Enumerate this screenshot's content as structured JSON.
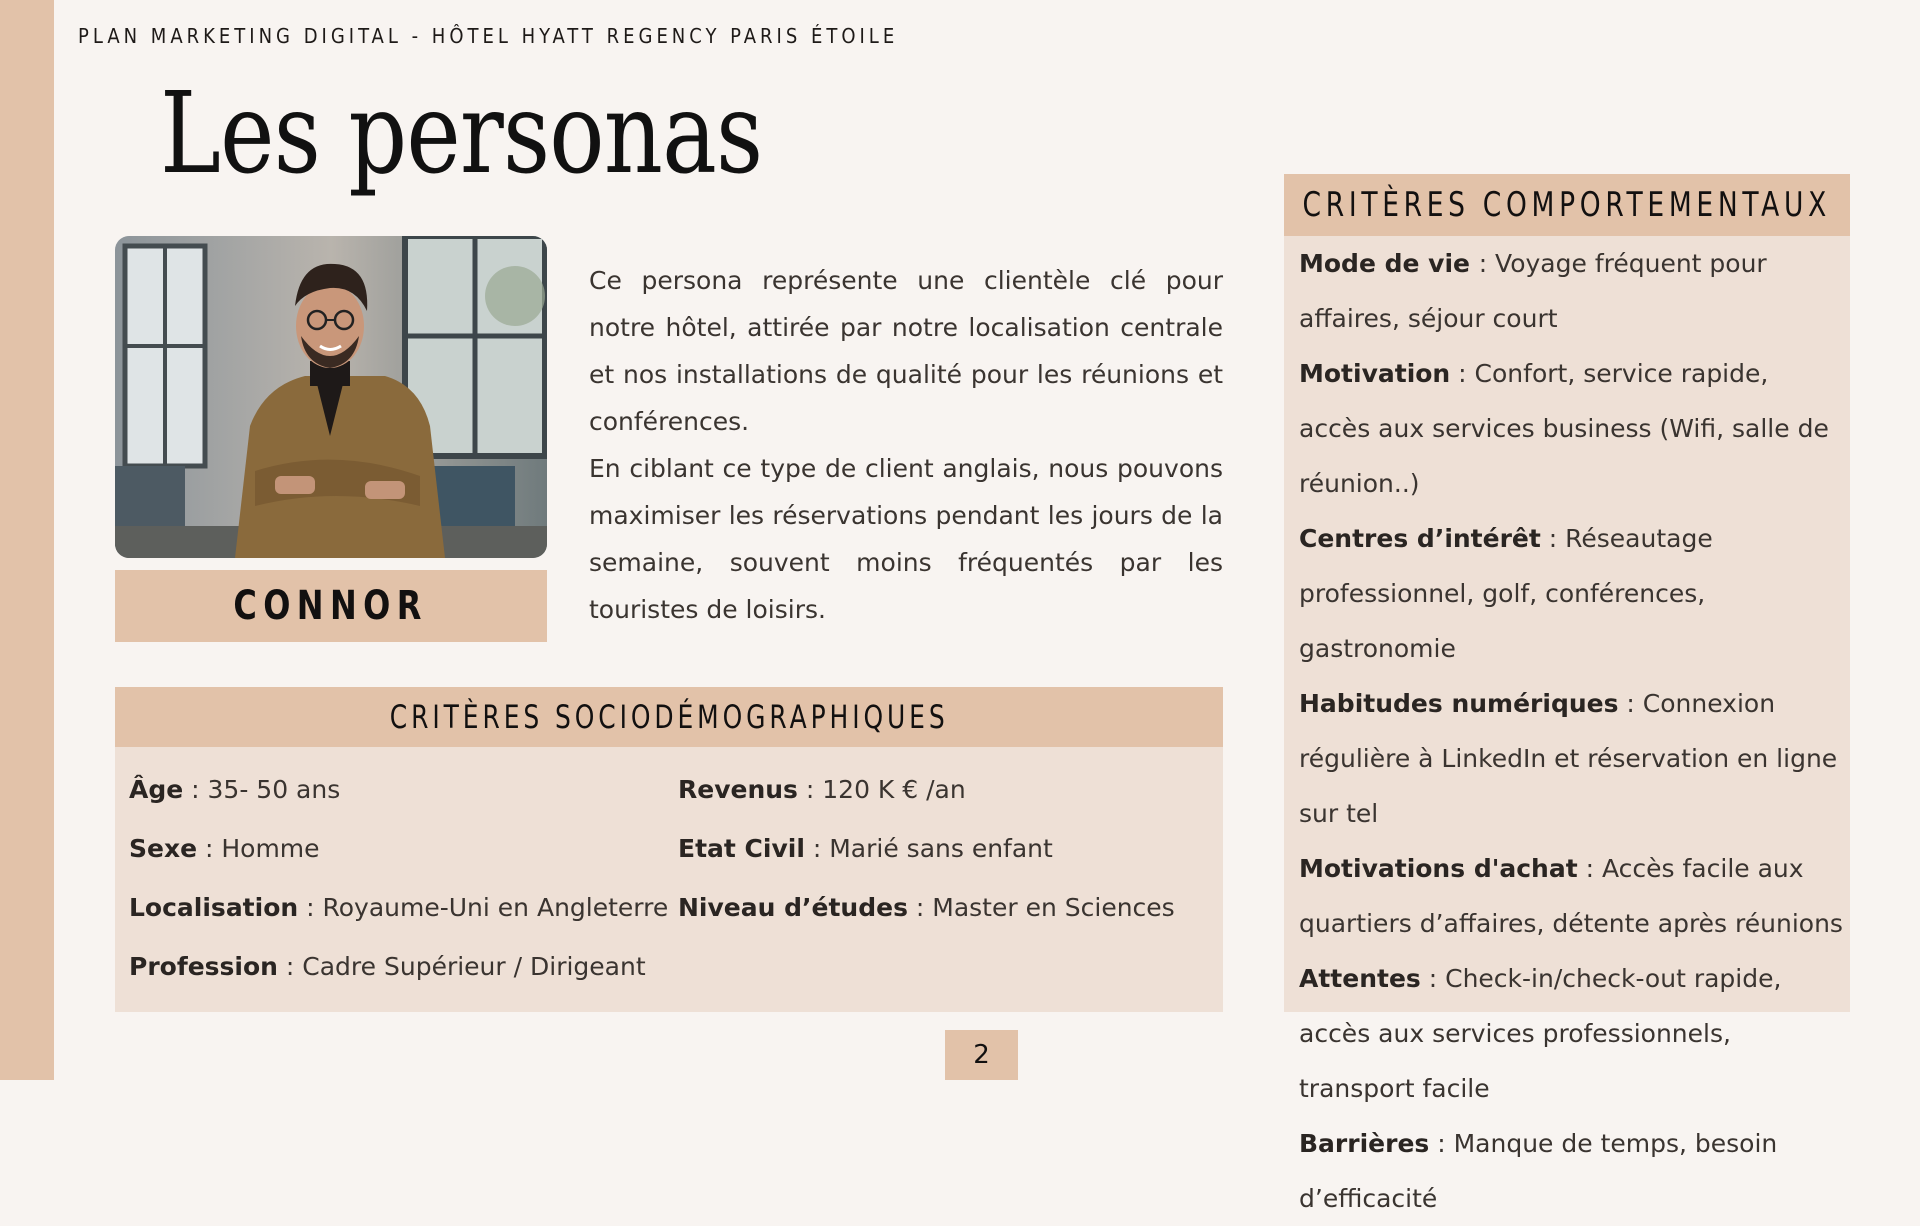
{
  "header": "PLAN MARKETING DIGITAL - HÔTEL HYATT REGENCY PARIS ÉTOILE",
  "title": "Les personas",
  "persona": {
    "name": "CONNOR",
    "photo_alt": "Portrait of a smiling man with glasses in a brown blazer, arms crossed"
  },
  "description": {
    "p1": "Ce persona représente une clientèle clé pour notre hôtel, attirée par notre localisation centrale et nos installations de qualité pour les réunions et conférences.",
    "p2": "En ciblant ce type de client anglais, nous pouvons maximiser les réservations pendant les jours de la semaine, souvent moins fréquentés par les touristes de loisirs."
  },
  "socio": {
    "title": "CRITÈRES SOCIODÉMOGRAPHIQUES",
    "items": [
      {
        "label": "Âge",
        "value": " : 35- 50 ans"
      },
      {
        "label": "Revenus",
        "value": " : 120 K € /an"
      },
      {
        "label": "Sexe",
        "value": " : Homme"
      },
      {
        "label": "Etat Civil",
        "value": " : Marié sans enfant"
      },
      {
        "label": "Localisation",
        "value": " : Royaume-Uni en Angleterre"
      },
      {
        "label": "Niveau d’études",
        "value": " : Master en Sciences"
      },
      {
        "label": "Profession",
        "value": " : Cadre Supérieur / Dirigeant"
      }
    ]
  },
  "behav": {
    "title": "CRITÈRES COMPORTEMENTAUX",
    "items": [
      {
        "label": "Mode de vie ",
        "value": " : Voyage fréquent pour affaires, séjour court"
      },
      {
        "label": "Motivation",
        "value": " : Confort, service rapide, accès aux services business (Wifi, salle de réunion..)"
      },
      {
        "label": "Centres d’intérêt",
        "value": " : Réseautage professionnel, golf, conférences, gastronomie"
      },
      {
        "label": "Habitudes numériques",
        "value": " : Connexion régulière à LinkedIn et réservation en ligne sur tel"
      },
      {
        "label": "Motivations d'achat",
        "value": " : Accès facile aux quartiers d’affaires, détente après réunions"
      },
      {
        "label": "Attentes",
        "value": " : Check-in/check-out rapide, accès aux services professionnels, transport facile"
      },
      {
        "label": "Barrières",
        "value": " : Manque de temps, besoin d’efficacité"
      }
    ]
  },
  "page_number": "2",
  "colors": {
    "accent": "#e2c2a9",
    "panel": "#eee0d6",
    "background": "#f8f4f1"
  }
}
